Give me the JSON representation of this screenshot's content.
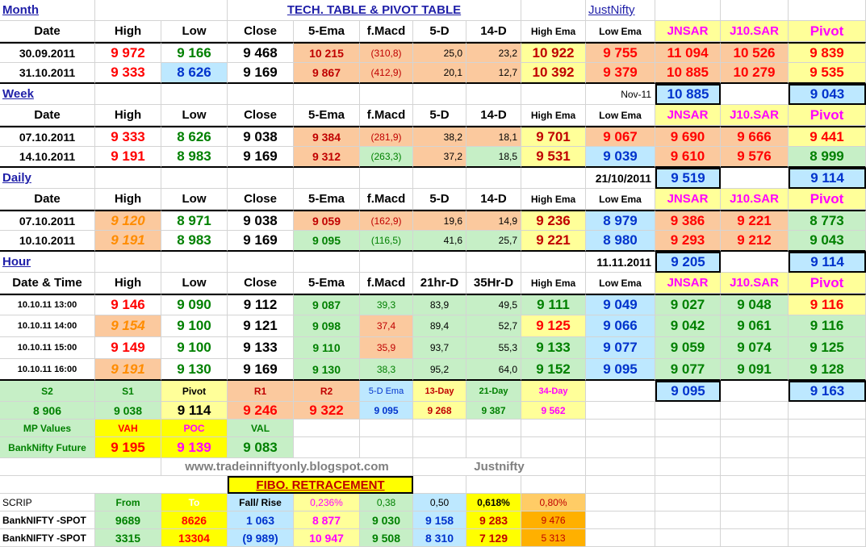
{
  "title": "TECH. TABLE  & PIVOT TABLE",
  "brand": "JustNifty",
  "headers": {
    "date": "Date",
    "date_time": "Date & Time",
    "high": "High",
    "low": "Low",
    "close": "Close",
    "ema5": "5-Ema",
    "fmacd": "f.Macd",
    "d5": "5-D",
    "d14": "14-D",
    "hr21": "21hr-D",
    "hr35": "35Hr-D",
    "high_ema": "High Ema",
    "low_ema": "Low Ema",
    "jnsar": "JNSAR",
    "j10sar": "J10.SAR",
    "pivot": "Pivot"
  },
  "month": {
    "label": "Month",
    "rows": [
      [
        "30.09.2011",
        "9 972",
        "9 166",
        "9 468",
        "10 215",
        "(310,8)",
        "25,0",
        "23,2",
        "10 922",
        "9 755",
        "11 094",
        "10 526",
        "9 839"
      ],
      [
        "31.10.2011",
        "9 333",
        "8 626",
        "9 169",
        "9 867",
        "(412,9)",
        "20,1",
        "12,7",
        "10 392",
        "9 379",
        "10 885",
        "10 279",
        "9 535"
      ]
    ],
    "next_label": "Nov-11",
    "next_jnsar": "10 885",
    "next_pivot": "9 043"
  },
  "week": {
    "label": "Week",
    "rows": [
      [
        "07.10.2011",
        "9 333",
        "8 626",
        "9 038",
        "9 384",
        "(281,9)",
        "38,2",
        "18,1",
        "9 701",
        "9 067",
        "9 690",
        "9 666",
        "9 441"
      ],
      [
        "14.10.2011",
        "9 191",
        "8 983",
        "9 169",
        "9 312",
        "(263,3)",
        "37,2",
        "18,5",
        "9 531",
        "9 039",
        "9 610",
        "9 576",
        "8 999"
      ]
    ],
    "next_label": "21/10/2011",
    "next_jnsar": "9 519",
    "next_pivot": "9 114"
  },
  "daily": {
    "label": "Daily",
    "rows": [
      [
        "07.10.2011",
        "9 120",
        "8 971",
        "9 038",
        "9 059",
        "(162,9)",
        "19,6",
        "14,9",
        "9 236",
        "8 979",
        "9 386",
        "9 221",
        "8 773"
      ],
      [
        "10.10.2011",
        "9 191",
        "8 983",
        "9 169",
        "9 095",
        "(116,5)",
        "41,6",
        "25,7",
        "9 221",
        "8 980",
        "9 293",
        "9 212",
        "9 043"
      ]
    ],
    "next_label": "11.11.2011",
    "next_jnsar": "9 205",
    "next_pivot": "9 114"
  },
  "hour": {
    "label": "Hour",
    "rows": [
      [
        "10.10.11 13:00",
        "9 146",
        "9 090",
        "9 112",
        "9 087",
        "39,3",
        "83,9",
        "49,5",
        "9 111",
        "9 049",
        "9 027",
        "9 048",
        "9 116"
      ],
      [
        "10.10.11 14:00",
        "9 154",
        "9 100",
        "9 121",
        "9 098",
        "37,4",
        "89,4",
        "52,7",
        "9 125",
        "9 066",
        "9 042",
        "9 061",
        "9 116"
      ],
      [
        "10.10.11 15:00",
        "9 149",
        "9 100",
        "9 133",
        "9 110",
        "35,9",
        "93,7",
        "55,3",
        "9 133",
        "9 077",
        "9 059",
        "9 074",
        "9 125"
      ],
      [
        "10.10.11 16:00",
        "9 191",
        "9 130",
        "9 169",
        "9 130",
        "38,3",
        "95,2",
        "64,0",
        "9 152",
        "9 095",
        "9 077",
        "9 091",
        "9 128"
      ]
    ],
    "next_jnsar": "9 095",
    "next_pivot": "9 163"
  },
  "levels": {
    "labels": [
      "S2",
      "S1",
      "Pivot",
      "R1",
      "R2",
      "5-D Ema",
      "13-Day",
      "21-Day",
      "34-Day"
    ],
    "values": [
      "8 906",
      "9 038",
      "9 114",
      "9 246",
      "9 322",
      "9 095",
      "9 268",
      "9 387",
      "9 562"
    ]
  },
  "mp": {
    "label": "MP Values",
    "vah": "VAH",
    "poc": "POC",
    "val": "VAL",
    "future_label": "BankNifty Future",
    "vah_value": "9 195",
    "poc_value": "9 139",
    "val_value": "9 083"
  },
  "website": "www.tradeinniftyonly.blogspot.com",
  "signature": "Justnifty",
  "fibo": {
    "title": "FIBO. RETRACEMENT",
    "headers": [
      "SCRIP",
      "From",
      "To",
      "Fall/ Rise",
      "0,236%",
      "0,38",
      "0,50",
      "0,618%",
      "0,80%"
    ],
    "rows": [
      [
        "BankNIFTY -SPOT",
        "9689",
        "8626",
        "1 063",
        "8 877",
        "9 030",
        "9 158",
        "9 283",
        "9 476"
      ],
      [
        "BankNIFTY -SPOT",
        "3315",
        "13304",
        "(9 989)",
        "10 947",
        "9 508",
        "8 310",
        "7 129",
        "5 313"
      ]
    ]
  },
  "colors": {
    "orange_fill": "#fbc99e",
    "green_fill": "#c6efc6",
    "yellow_fill": "#ffff99",
    "blue_fill": "#bde8ff",
    "red_text": "#ff0000",
    "green_text": "#008000",
    "magenta_text": "#ff00ff"
  }
}
